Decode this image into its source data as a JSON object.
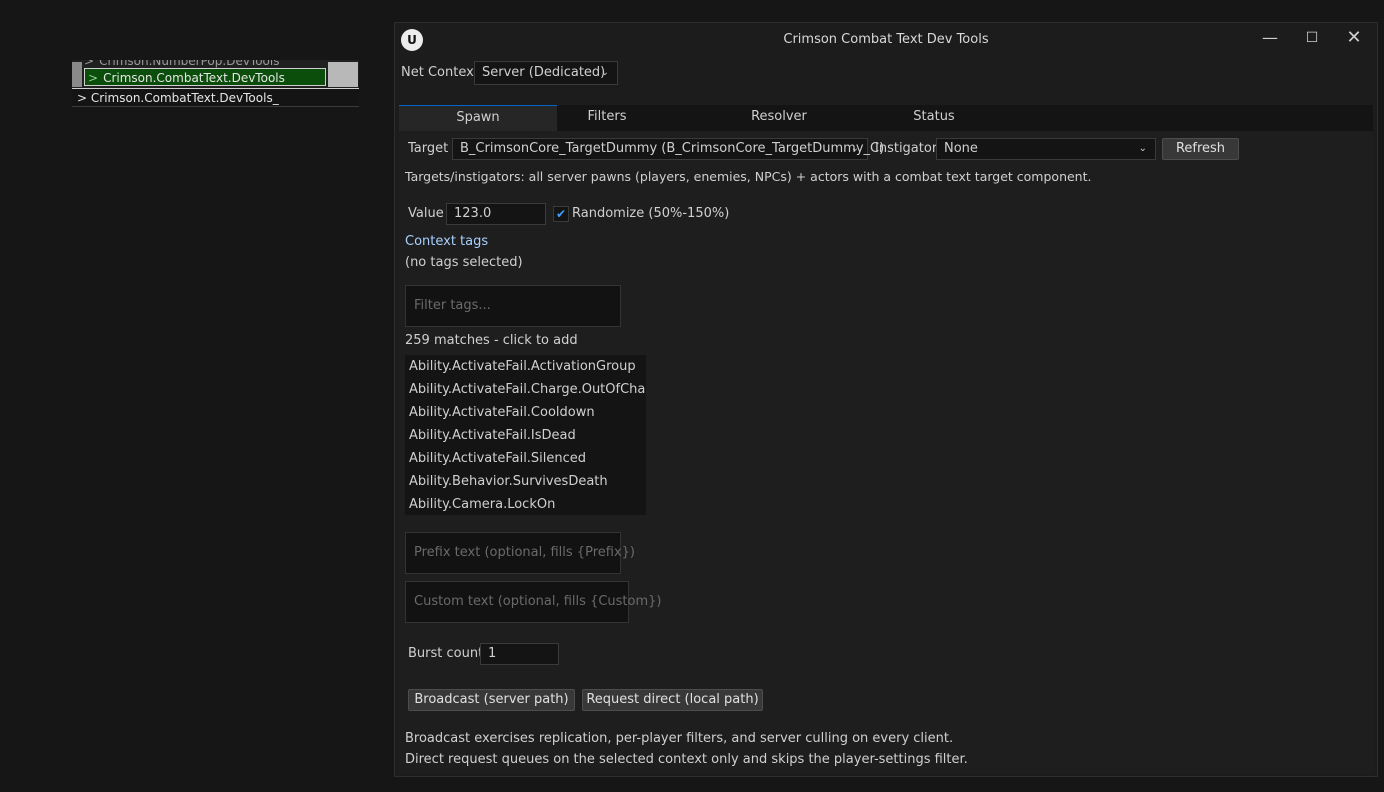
{
  "console": {
    "suggestion_1": "Crimson.NumberPop.DevTools",
    "suggestion_2": "Crimson.CombatText.DevTools",
    "prompt": ">",
    "input": "Crimson.CombatText.DevTools_"
  },
  "window": {
    "title": "Crimson Combat Text Dev Tools",
    "logo": "unreal-logo",
    "controls": [
      "minimize-icon",
      "maximize-icon",
      "close-icon"
    ]
  },
  "net_context": {
    "label": "Net Context",
    "value": "Server (Dedicated)"
  },
  "tabs": [
    {
      "label": "Spawn",
      "active": true
    },
    {
      "label": "Filters",
      "active": false
    },
    {
      "label": "Resolver",
      "active": false
    },
    {
      "label": "Status",
      "active": false
    }
  ],
  "spawn": {
    "target_label": "Target",
    "target_value": "B_CrimsonCore_TargetDummy (B_CrimsonCore_TargetDummy_C)",
    "instigator_label": "Instigator",
    "instigator_value": "None",
    "refresh_label": "Refresh",
    "targets_hint": "Targets/instigators: all server pawns (players, enemies, NPCs) + actors with a combat text target component.",
    "value_label": "Value",
    "value": "123.0",
    "randomize_label": "Randomize (50%-150%)",
    "randomize_checked": true,
    "context_tags_label": "Context tags",
    "no_tags": "(no tags selected)",
    "filter_placeholder": "Filter tags...",
    "matches": "259 matches - click to add",
    "tags": [
      "Ability.ActivateFail.ActivationGroup",
      "Ability.ActivateFail.Charge.OutOfCharges",
      "Ability.ActivateFail.Cooldown",
      "Ability.ActivateFail.IsDead",
      "Ability.ActivateFail.Silenced",
      "Ability.Behavior.SurvivesDeath",
      "Ability.Camera.LockOn"
    ],
    "prefix_placeholder": "Prefix text (optional, fills {Prefix})",
    "custom_placeholder": "Custom text (optional, fills {Custom})",
    "burst_label": "Burst count",
    "burst_value": "1",
    "broadcast_label": "Broadcast (server path)",
    "request_label": "Request direct (local path)",
    "note_1": "Broadcast exercises replication, per-player filters, and server culling on every client.",
    "note_2": "Direct request queues on the selected context only and skips the player-settings filter."
  }
}
